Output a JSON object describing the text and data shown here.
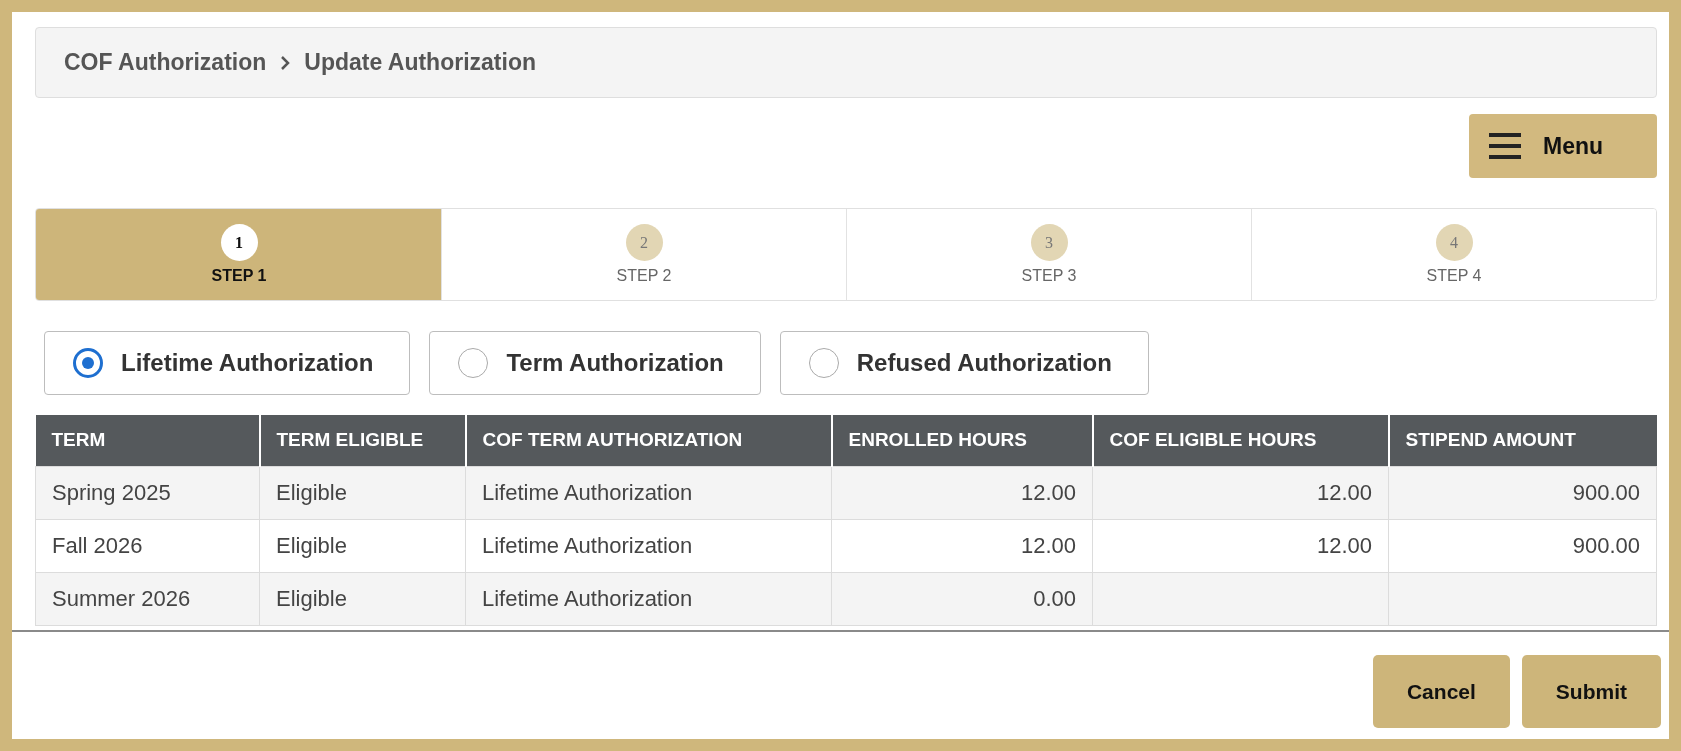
{
  "breadcrumb": [
    {
      "label": "COF Authorization"
    },
    {
      "label": "Update Authorization"
    }
  ],
  "menu_button": {
    "label": "Menu"
  },
  "steps": [
    {
      "number": "1",
      "label": "STEP 1",
      "selected": true
    },
    {
      "number": "2",
      "label": "STEP 2",
      "selected": false
    },
    {
      "number": "3",
      "label": "STEP 3",
      "selected": false
    },
    {
      "number": "4",
      "label": "STEP 4",
      "selected": false
    }
  ],
  "authorization_options": [
    {
      "label": "Lifetime Authorization",
      "selected": true
    },
    {
      "label": "Term Authorization",
      "selected": false
    },
    {
      "label": "Refused Authorization",
      "selected": false
    }
  ],
  "table": {
    "columns": [
      "TERM",
      "TERM ELIGIBLE",
      "COF TERM AUTHORIZATION",
      "ENROLLED HOURS",
      "COF ELIGIBLE HOURS",
      "STIPEND AMOUNT"
    ],
    "rows": [
      {
        "cells": [
          "Spring 2025",
          "Eligible",
          "Lifetime Authorization",
          "12.00",
          "12.00",
          "900.00"
        ]
      },
      {
        "cells": [
          "Fall 2026",
          "Eligible",
          "Lifetime Authorization",
          "12.00",
          "12.00",
          "900.00"
        ]
      },
      {
        "cells": [
          "Summer 2026",
          "Eligible",
          "Lifetime Authorization",
          "0.00"
        ]
      }
    ]
  },
  "buttons": [
    {
      "label": "Cancel"
    },
    {
      "label": "Submit"
    }
  ]
}
